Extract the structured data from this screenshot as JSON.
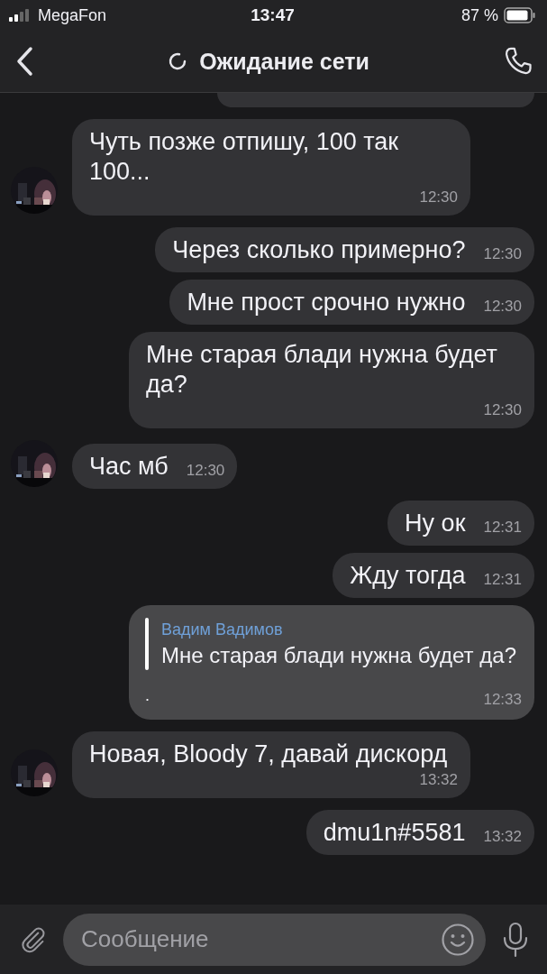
{
  "status_bar": {
    "carrier": "MegaFon",
    "time": "13:47",
    "battery": "87 %"
  },
  "header": {
    "title": "Ожидание сети"
  },
  "messages": [
    {
      "kind": "partial"
    },
    {
      "kind": "in",
      "text": "Чуть позже отпишу, 100 так 100...",
      "time": "12:30"
    },
    {
      "kind": "out",
      "text": "Через сколько примерно?",
      "time": "12:30"
    },
    {
      "kind": "out",
      "text": "Мне прост срочно нужно",
      "time": "12:30"
    },
    {
      "kind": "out",
      "text": "Мне старая блади нужна будет да?",
      "time": "12:30"
    },
    {
      "kind": "in",
      "text": "Час мб",
      "time": "12:30"
    },
    {
      "kind": "out",
      "text": "Ну ок",
      "time": "12:31"
    },
    {
      "kind": "out",
      "text": "Жду тогда",
      "time": "12:31"
    },
    {
      "kind": "reply",
      "quote_author": "Вадим Вадимов",
      "quote_text": "Мне старая блади нужна будет да?",
      "text": ".",
      "time": "12:33"
    },
    {
      "kind": "in",
      "text": "Новая, Bloody 7, давай дискорд",
      "time": "13:32"
    },
    {
      "kind": "out",
      "text": "dmu1n#5581",
      "time": "13:32"
    }
  ],
  "composer": {
    "placeholder": "Сообщение"
  }
}
